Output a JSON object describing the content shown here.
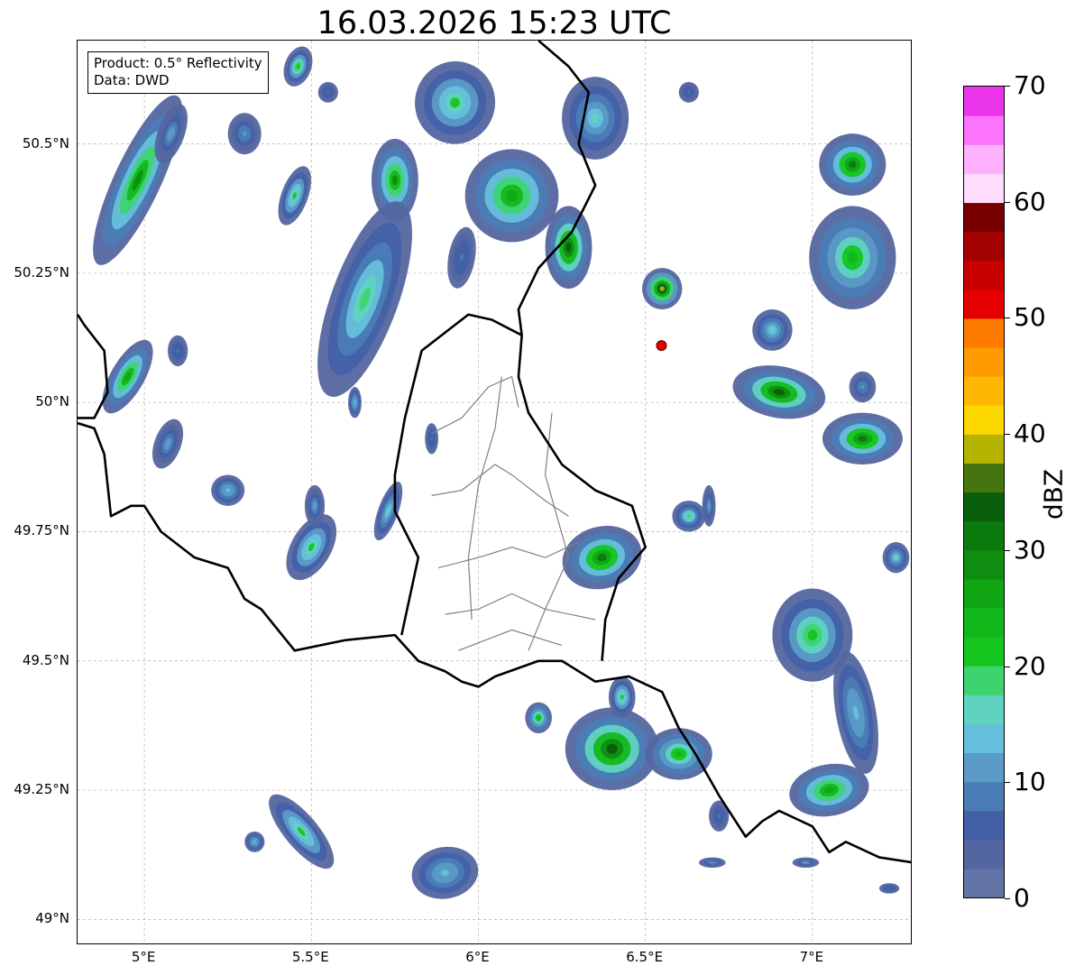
{
  "title": "16.03.2026 15:23 UTC",
  "info_box": {
    "product": "Product: 0.5° Reflectivity",
    "data": "Data: DWD"
  },
  "map": {
    "lon_range": [
      4.8,
      7.3
    ],
    "lat_range": [
      48.95,
      50.7
    ],
    "lat_ticks": [
      {
        "value": 49.0,
        "label": "49°N"
      },
      {
        "value": 49.25,
        "label": "49.25°N"
      },
      {
        "value": 49.5,
        "label": "49.5°N"
      },
      {
        "value": 49.75,
        "label": "49.75°N"
      },
      {
        "value": 50.0,
        "label": "50°N"
      },
      {
        "value": 50.25,
        "label": "50.25°N"
      },
      {
        "value": 50.5,
        "label": "50.5°N"
      }
    ],
    "lon_ticks": [
      {
        "value": 5.0,
        "label": "5°E"
      },
      {
        "value": 5.5,
        "label": "5.5°E"
      },
      {
        "value": 6.0,
        "label": "6°E"
      },
      {
        "value": 6.5,
        "label": "6.5°E"
      },
      {
        "value": 7.0,
        "label": "7°E"
      }
    ],
    "radar_site": {
      "lon": 6.548,
      "lat": 50.11,
      "color": "#e60000"
    },
    "echo_cells": [
      {
        "lon": 4.98,
        "lat": 50.43,
        "a": 0.07,
        "b": 0.18,
        "rot": 25,
        "level": 28
      },
      {
        "lon": 5.08,
        "lat": 50.52,
        "a": 0.04,
        "b": 0.06,
        "rot": 20,
        "level": 12
      },
      {
        "lon": 5.3,
        "lat": 50.52,
        "a": 0.05,
        "b": 0.04,
        "rot": 0,
        "level": 10
      },
      {
        "lon": 5.46,
        "lat": 50.65,
        "a": 0.04,
        "b": 0.04,
        "rot": 20,
        "level": 22
      },
      {
        "lon": 5.55,
        "lat": 50.6,
        "a": 0.03,
        "b": 0.02,
        "rot": 0,
        "level": 8
      },
      {
        "lon": 5.45,
        "lat": 50.4,
        "a": 0.04,
        "b": 0.06,
        "rot": 20,
        "level": 20
      },
      {
        "lon": 5.75,
        "lat": 50.43,
        "a": 0.07,
        "b": 0.08,
        "rot": 0,
        "level": 28
      },
      {
        "lon": 5.66,
        "lat": 50.2,
        "a": 0.1,
        "b": 0.2,
        "rot": 20,
        "level": 18
      },
      {
        "lon": 5.93,
        "lat": 50.58,
        "a": 0.12,
        "b": 0.08,
        "rot": 10,
        "level": 20
      },
      {
        "lon": 5.95,
        "lat": 50.28,
        "a": 0.04,
        "b": 0.06,
        "rot": 10,
        "level": 8
      },
      {
        "lon": 6.1,
        "lat": 50.4,
        "a": 0.14,
        "b": 0.09,
        "rot": 0,
        "level": 26
      },
      {
        "lon": 6.27,
        "lat": 50.3,
        "a": 0.07,
        "b": 0.08,
        "rot": 0,
        "level": 34
      },
      {
        "lon": 6.35,
        "lat": 50.55,
        "a": 0.1,
        "b": 0.08,
        "rot": 0,
        "level": 16
      },
      {
        "lon": 6.55,
        "lat": 50.22,
        "a": 0.06,
        "b": 0.04,
        "rot": 0,
        "level": 38
      },
      {
        "lon": 4.95,
        "lat": 50.05,
        "a": 0.05,
        "b": 0.08,
        "rot": 30,
        "level": 26
      },
      {
        "lon": 5.07,
        "lat": 49.92,
        "a": 0.04,
        "b": 0.05,
        "rot": 20,
        "level": 12
      },
      {
        "lon": 5.1,
        "lat": 50.1,
        "a": 0.03,
        "b": 0.03,
        "rot": 0,
        "level": 8
      },
      {
        "lon": 5.25,
        "lat": 49.83,
        "a": 0.05,
        "b": 0.03,
        "rot": 0,
        "level": 14
      },
      {
        "lon": 5.5,
        "lat": 49.72,
        "a": 0.06,
        "b": 0.07,
        "rot": 30,
        "level": 20
      },
      {
        "lon": 5.51,
        "lat": 49.8,
        "a": 0.03,
        "b": 0.04,
        "rot": 0,
        "level": 12
      },
      {
        "lon": 5.73,
        "lat": 49.79,
        "a": 0.03,
        "b": 0.06,
        "rot": 20,
        "level": 16
      },
      {
        "lon": 5.63,
        "lat": 50.0,
        "a": 0.02,
        "b": 0.03,
        "rot": 0,
        "level": 14
      },
      {
        "lon": 5.86,
        "lat": 49.93,
        "a": 0.02,
        "b": 0.03,
        "rot": 0,
        "level": 8
      },
      {
        "lon": 6.37,
        "lat": 49.7,
        "a": 0.12,
        "b": 0.06,
        "rot": -15,
        "level": 30
      },
      {
        "lon": 6.63,
        "lat": 49.78,
        "a": 0.05,
        "b": 0.03,
        "rot": 0,
        "level": 18
      },
      {
        "lon": 6.88,
        "lat": 50.14,
        "a": 0.06,
        "b": 0.04,
        "rot": 0,
        "level": 16
      },
      {
        "lon": 6.9,
        "lat": 50.02,
        "a": 0.14,
        "b": 0.05,
        "rot": 10,
        "level": 34
      },
      {
        "lon": 7.15,
        "lat": 49.93,
        "a": 0.12,
        "b": 0.05,
        "rot": 0,
        "level": 30
      },
      {
        "lon": 7.15,
        "lat": 50.03,
        "a": 0.04,
        "b": 0.03,
        "rot": 0,
        "level": 10
      },
      {
        "lon": 7.12,
        "lat": 50.28,
        "a": 0.13,
        "b": 0.1,
        "rot": 0,
        "level": 24
      },
      {
        "lon": 7.12,
        "lat": 50.46,
        "a": 0.1,
        "b": 0.06,
        "rot": 0,
        "level": 30
      },
      {
        "lon": 6.63,
        "lat": 50.6,
        "a": 0.03,
        "b": 0.02,
        "rot": 0,
        "level": 8
      },
      {
        "lon": 6.69,
        "lat": 49.8,
        "a": 0.02,
        "b": 0.04,
        "rot": 0,
        "level": 12
      },
      {
        "lon": 7.0,
        "lat": 49.55,
        "a": 0.12,
        "b": 0.09,
        "rot": 0,
        "level": 22
      },
      {
        "lon": 7.13,
        "lat": 49.4,
        "a": 0.06,
        "b": 0.12,
        "rot": -10,
        "level": 14
      },
      {
        "lon": 7.05,
        "lat": 49.25,
        "a": 0.12,
        "b": 0.05,
        "rot": -10,
        "level": 26
      },
      {
        "lon": 7.25,
        "lat": 49.7,
        "a": 0.04,
        "b": 0.03,
        "rot": 0,
        "level": 16
      },
      {
        "lon": 6.4,
        "lat": 49.33,
        "a": 0.14,
        "b": 0.08,
        "rot": 0,
        "level": 34
      },
      {
        "lon": 6.6,
        "lat": 49.32,
        "a": 0.1,
        "b": 0.05,
        "rot": 0,
        "level": 24
      },
      {
        "lon": 6.43,
        "lat": 49.43,
        "a": 0.04,
        "b": 0.04,
        "rot": 0,
        "level": 20
      },
      {
        "lon": 6.18,
        "lat": 49.39,
        "a": 0.04,
        "b": 0.03,
        "rot": 0,
        "level": 24
      },
      {
        "lon": 6.72,
        "lat": 49.2,
        "a": 0.03,
        "b": 0.03,
        "rot": 0,
        "level": 8
      },
      {
        "lon": 6.7,
        "lat": 49.11,
        "a": 0.04,
        "b": 0.01,
        "rot": 0,
        "level": 10
      },
      {
        "lon": 5.47,
        "lat": 49.17,
        "a": 0.05,
        "b": 0.09,
        "rot": -40,
        "level": 20
      },
      {
        "lon": 5.33,
        "lat": 49.15,
        "a": 0.03,
        "b": 0.02,
        "rot": 0,
        "level": 14
      },
      {
        "lon": 5.9,
        "lat": 49.09,
        "a": 0.1,
        "b": 0.05,
        "rot": -10,
        "level": 14
      },
      {
        "lon": 6.98,
        "lat": 49.11,
        "a": 0.04,
        "b": 0.01,
        "rot": 0,
        "level": 12
      },
      {
        "lon": 7.23,
        "lat": 49.06,
        "a": 0.03,
        "b": 0.01,
        "rot": 0,
        "level": 8
      }
    ],
    "borders": [
      [
        [
          4.8,
          50.17
        ],
        [
          4.82,
          50.15
        ],
        [
          4.88,
          50.1
        ],
        [
          4.89,
          50.02
        ],
        [
          4.85,
          49.97
        ],
        [
          4.8,
          49.97
        ]
      ],
      [
        [
          4.8,
          49.96
        ],
        [
          4.85,
          49.95
        ],
        [
          4.88,
          49.9
        ],
        [
          4.9,
          49.78
        ],
        [
          4.96,
          49.8
        ],
        [
          5.0,
          49.8
        ],
        [
          5.05,
          49.75
        ],
        [
          5.15,
          49.7
        ],
        [
          5.25,
          49.68
        ],
        [
          5.3,
          49.62
        ],
        [
          5.35,
          49.6
        ],
        [
          5.45,
          49.52
        ],
        [
          5.6,
          49.54
        ],
        [
          5.75,
          49.55
        ],
        [
          5.82,
          49.5
        ],
        [
          5.9,
          49.48
        ],
        [
          5.95,
          49.46
        ],
        [
          6.0,
          49.45
        ],
        [
          6.05,
          49.47
        ],
        [
          6.18,
          49.5
        ],
        [
          6.25,
          49.5
        ],
        [
          6.3,
          49.48
        ],
        [
          6.35,
          49.46
        ],
        [
          6.45,
          49.47
        ],
        [
          6.55,
          49.44
        ],
        [
          6.6,
          49.37
        ],
        [
          6.65,
          49.32
        ],
        [
          6.72,
          49.24
        ],
        [
          6.8,
          49.16
        ],
        [
          6.85,
          49.19
        ],
        [
          6.9,
          49.21
        ],
        [
          7.0,
          49.18
        ],
        [
          7.05,
          49.13
        ],
        [
          7.1,
          49.15
        ],
        [
          7.2,
          49.12
        ],
        [
          7.3,
          49.11
        ]
      ],
      [
        [
          6.13,
          50.13
        ],
        [
          6.12,
          50.05
        ],
        [
          6.15,
          49.98
        ],
        [
          6.25,
          49.88
        ],
        [
          6.35,
          49.83
        ],
        [
          6.46,
          49.8
        ],
        [
          6.5,
          49.72
        ],
        [
          6.42,
          49.66
        ],
        [
          6.38,
          49.58
        ],
        [
          6.37,
          49.5
        ]
      ],
      [
        [
          5.77,
          49.55
        ],
        [
          5.82,
          49.7
        ],
        [
          5.75,
          49.79
        ],
        [
          5.75,
          49.86
        ],
        [
          5.78,
          49.97
        ],
        [
          5.83,
          50.1
        ],
        [
          5.97,
          50.17
        ],
        [
          6.04,
          50.16
        ],
        [
          6.13,
          50.13
        ],
        [
          6.12,
          50.18
        ],
        [
          6.18,
          50.26
        ],
        [
          6.28,
          50.33
        ],
        [
          6.35,
          50.42
        ],
        [
          6.3,
          50.5
        ],
        [
          6.33,
          50.6
        ],
        [
          6.27,
          50.65
        ],
        [
          6.18,
          50.7
        ]
      ]
    ],
    "admin_lines": [
      [
        [
          5.86,
          49.94
        ],
        [
          5.95,
          49.97
        ],
        [
          6.03,
          50.03
        ],
        [
          6.1,
          50.05
        ],
        [
          6.12,
          49.99
        ]
      ],
      [
        [
          5.86,
          49.82
        ],
        [
          5.95,
          49.83
        ],
        [
          6.05,
          49.88
        ],
        [
          6.1,
          49.86
        ],
        [
          6.2,
          49.81
        ],
        [
          6.27,
          49.78
        ]
      ],
      [
        [
          5.88,
          49.68
        ],
        [
          6.0,
          49.7
        ],
        [
          6.1,
          49.72
        ],
        [
          6.2,
          49.7
        ],
        [
          6.3,
          49.73
        ]
      ],
      [
        [
          5.9,
          49.59
        ],
        [
          6.0,
          49.6
        ],
        [
          6.1,
          49.63
        ],
        [
          6.2,
          49.6
        ],
        [
          6.35,
          49.58
        ]
      ],
      [
        [
          5.94,
          49.52
        ],
        [
          6.1,
          49.56
        ],
        [
          6.25,
          49.53
        ]
      ],
      [
        [
          6.07,
          50.05
        ],
        [
          6.05,
          49.95
        ],
        [
          6.0,
          49.84
        ],
        [
          5.97,
          49.7
        ],
        [
          5.98,
          49.58
        ]
      ],
      [
        [
          6.22,
          49.98
        ],
        [
          6.2,
          49.86
        ],
        [
          6.27,
          49.7
        ],
        [
          6.2,
          49.6
        ],
        [
          6.15,
          49.52
        ]
      ]
    ],
    "colorbar": {
      "label": "dBZ",
      "min": 0,
      "max": 70,
      "ticks": [
        {
          "value": 0,
          "label": "0"
        },
        {
          "value": 10,
          "label": "10"
        },
        {
          "value": 20,
          "label": "20"
        },
        {
          "value": 30,
          "label": "30"
        },
        {
          "value": 40,
          "label": "40"
        },
        {
          "value": 50,
          "label": "50"
        },
        {
          "value": 60,
          "label": "60"
        },
        {
          "value": 70,
          "label": "70"
        }
      ],
      "colors": [
        "#6474a6",
        "#5466a0",
        "#4360a6",
        "#4a7cb6",
        "#5a9ac7",
        "#66c0dc",
        "#5fd3c0",
        "#3dd470",
        "#14c61e",
        "#12b81a",
        "#10a613",
        "#0e8d10",
        "#0b7a0d",
        "#0a5f0a",
        "#467510",
        "#b3b300",
        "#fcd800",
        "#fdb700",
        "#fd9b00",
        "#fe7b00",
        "#e40000",
        "#c90000",
        "#a30000",
        "#7a0000",
        "#fddcfd",
        "#fdb0fd",
        "#fc73fc",
        "#ea35ea"
      ]
    }
  }
}
